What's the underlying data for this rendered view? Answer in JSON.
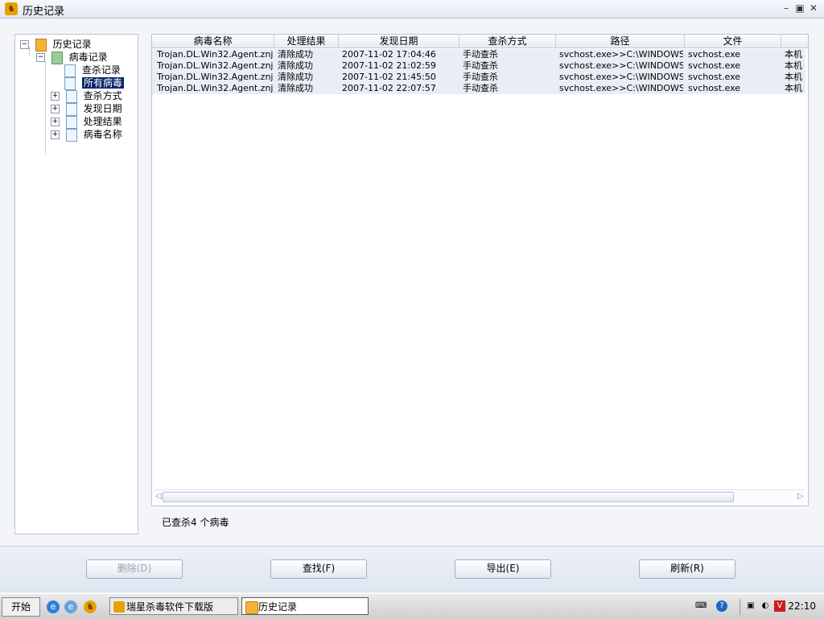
{
  "window": {
    "title": "历史记录",
    "controls": [
      "–",
      "▣",
      "✕"
    ]
  },
  "tree": {
    "root": "历史记录",
    "child": "病毒记录",
    "items": [
      "查杀记录",
      "所有病毒",
      "查杀方式",
      "发现日期",
      "处理结果",
      "病毒名称"
    ]
  },
  "table": {
    "columns": [
      "病毒名称",
      "处理结果",
      "发现日期",
      "查杀方式",
      "路径",
      "文件",
      ""
    ],
    "rows": [
      [
        "Trojan.DL.Win32.Agent.znj",
        "清除成功",
        "2007-11-02 17:04:46",
        "手动查杀",
        "svchost.exe>>C:\\WINDOWS...",
        "svchost.exe",
        "本机"
      ],
      [
        "Trojan.DL.Win32.Agent.znj",
        "清除成功",
        "2007-11-02 21:02:59",
        "手动查杀",
        "svchost.exe>>C:\\WINDOWS...",
        "svchost.exe",
        "本机"
      ],
      [
        "Trojan.DL.Win32.Agent.znj",
        "清除成功",
        "2007-11-02 21:45:50",
        "手动查杀",
        "svchost.exe>>C:\\WINDOWS...",
        "svchost.exe",
        "本机"
      ],
      [
        "Trojan.DL.Win32.Agent.znj",
        "清除成功",
        "2007-11-02 22:07:57",
        "手动查杀",
        "svchost.exe>>C:\\WINDOWS...",
        "svchost.exe",
        "本机"
      ]
    ]
  },
  "status": "已查杀4 个病毒",
  "buttons": {
    "delete": "删除(D)",
    "find": "查找(F)",
    "export": "导出(E)",
    "refresh": "刷新(R)"
  },
  "taskbar": {
    "start": "开始",
    "task1": "瑞星杀毒软件下载版",
    "task2": "历史记录",
    "clock": "22:10"
  },
  "colors": {
    "selection": "#0a246a",
    "row_bg": "#e9eef6",
    "accent": "#e6a100"
  }
}
